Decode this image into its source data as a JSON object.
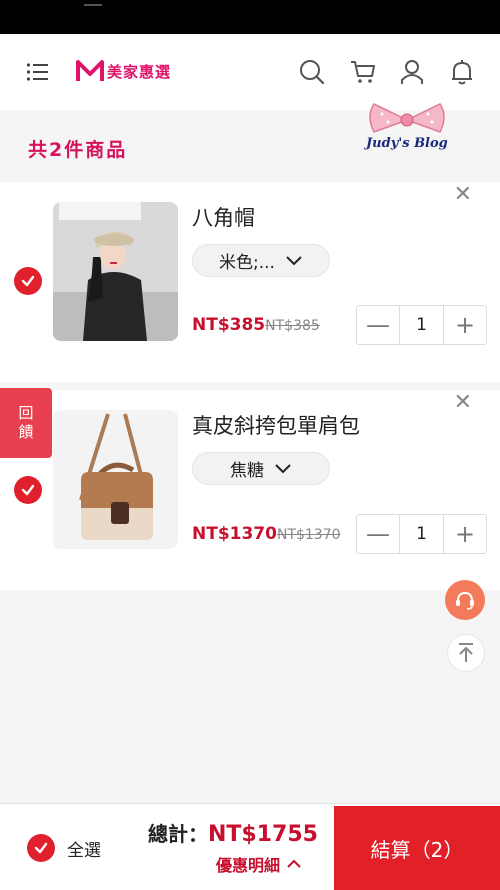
{
  "header": {
    "logo_text": "美家惠選"
  },
  "cart": {
    "count_text": "共2件商品"
  },
  "watermark": {
    "blog_text": "Judy's Blog"
  },
  "items": [
    {
      "title": "八角帽",
      "variant": "米色;...",
      "price_now": "NT$385",
      "price_old": "NT$385",
      "quantity": "1",
      "checked": true
    },
    {
      "title": "真皮斜挎包單肩包",
      "variant": "焦糖",
      "price_now": "NT$1370",
      "price_old": "NT$1370",
      "quantity": "1",
      "checked": true
    }
  ],
  "feedback": {
    "line1": "回",
    "line2": "饋"
  },
  "footer": {
    "select_all_label": "全選",
    "total_label": "總計：",
    "total_value": "NT$1755",
    "discount_label": "優惠明細",
    "checkout_label": "結算（2）"
  },
  "colors": {
    "brand": "#e0136b",
    "accent_red": "#e12028",
    "price_red": "#c8102e"
  },
  "icons": [
    "menu-icon",
    "search-icon",
    "cart-icon",
    "user-icon",
    "bell-icon",
    "check-icon",
    "close-icon",
    "chevron-down-icon",
    "headset-icon",
    "back-to-top-icon",
    "chevron-up-icon"
  ]
}
